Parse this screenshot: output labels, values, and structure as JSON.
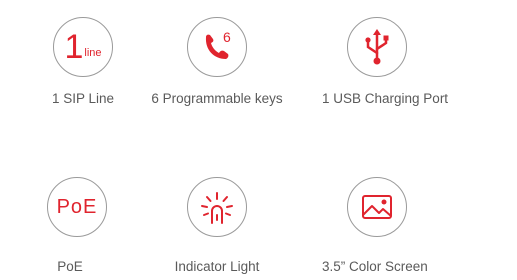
{
  "accent_color": "#e0242e",
  "features": [
    {
      "id": "sip",
      "icon": "sip-line-icon",
      "icon_text_big": "1",
      "icon_text_small": "line",
      "label": "1 SIP Line"
    },
    {
      "id": "keys",
      "icon": "phone-handset-icon",
      "icon_text_small": "6",
      "label": "6 Programmable keys"
    },
    {
      "id": "usb",
      "icon": "usb-icon",
      "label": "1 USB Charging Port"
    },
    {
      "id": "poe",
      "icon": "poe-icon",
      "icon_text": "PoE",
      "label": "PoE"
    },
    {
      "id": "light",
      "icon": "indicator-light-icon",
      "label": "Indicator  Light"
    },
    {
      "id": "screen",
      "icon": "picture-screen-icon",
      "label": "3.5”  Color Screen"
    }
  ]
}
